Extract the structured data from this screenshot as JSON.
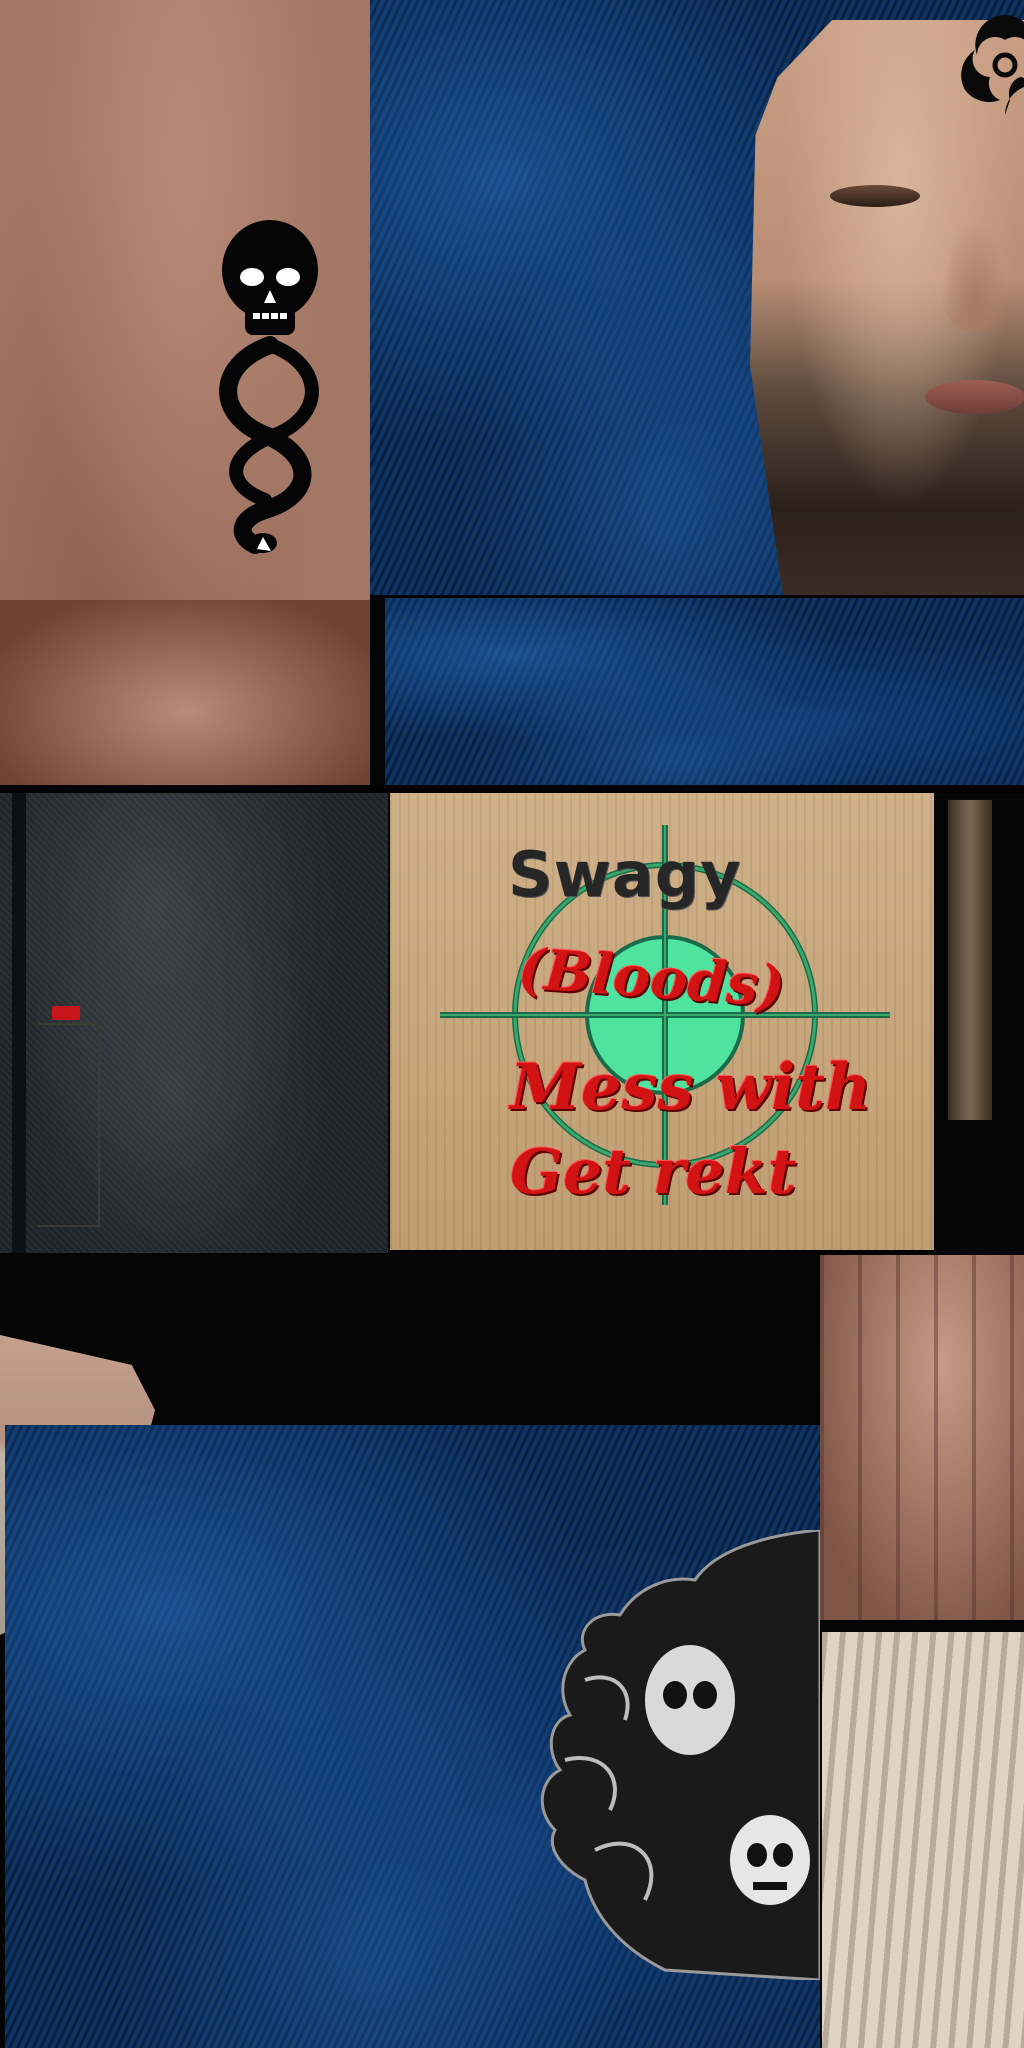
{
  "texture": {
    "label_title": "Swagy",
    "label_group": "(Bloods)",
    "label_line1": "Mess with",
    "label_line2": "Get rekt"
  },
  "colors": {
    "blue_base": "#0b2b55",
    "text_red": "#d21313",
    "text_dark": "#262626",
    "crosshair_green": "#3aa86b",
    "crosshair_fill": "#4fe3a0"
  },
  "icons": [
    "dark-mark-skull-snake-icon",
    "biohazard-icon",
    "reaper-punisher-skull-icon",
    "levis-tab-icon"
  ]
}
